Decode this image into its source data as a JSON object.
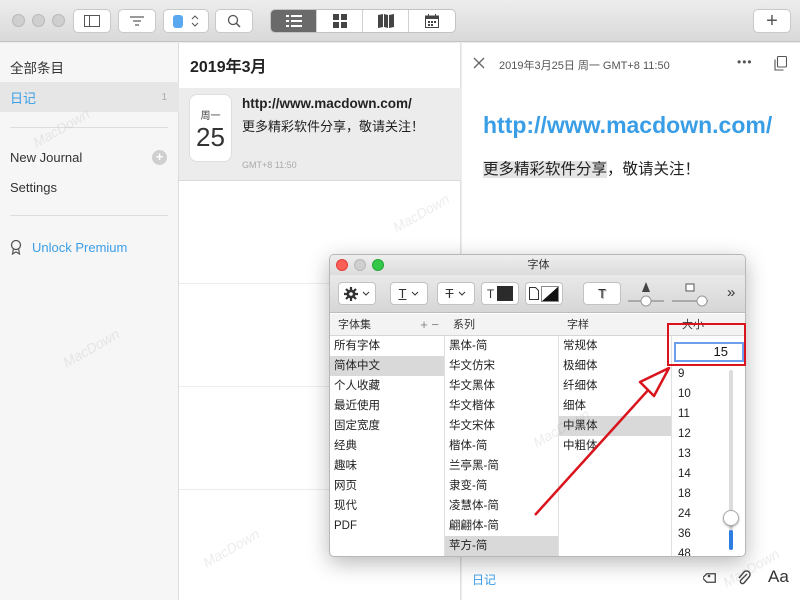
{
  "toolbar": {
    "add_label": "+"
  },
  "sidebar": {
    "all_entries": "全部条目",
    "journal": "日记",
    "journal_count": "1",
    "new_journal": "New Journal",
    "new_journal_plus": "+",
    "settings": "Settings",
    "unlock": "Unlock Premium"
  },
  "list": {
    "month": "2019年3月",
    "entry": {
      "weekday": "周一",
      "day": "25",
      "title": "http://www.macdown.com/",
      "body": "更多精彩软件分享，敬请关注！",
      "time": "GMT+8 11:50"
    }
  },
  "detail": {
    "datetime": "2019年3月25日 周一 GMT+8 11:50",
    "more": "•••",
    "link": "http://www.macdown.com/",
    "body_highlight": "更多精彩软件分享",
    "body_rest": "，敬请关注！",
    "journal_tag": "日记",
    "font_button": "Aa"
  },
  "font_panel": {
    "title": "字体",
    "columns": {
      "collection": "字体集",
      "family": "系列",
      "typeface": "字样",
      "size": "大小"
    },
    "collection_actions": "+ −",
    "overflow": "»",
    "collections": [
      "所有字体",
      "简体中文",
      "个人收藏",
      "最近使用",
      "固定宽度",
      "经典",
      "趣味",
      "网页",
      "现代",
      "PDF"
    ],
    "families": [
      "黑体-简",
      "华文仿宋",
      "华文黑体",
      "华文楷体",
      "华文宋体",
      "楷体-简",
      "兰亭黑-简",
      "隶变-简",
      "凌慧体-简",
      "翩翩体-简",
      "苹方-简"
    ],
    "typefaces": [
      "常规体",
      "极细体",
      "纤细体",
      "细体",
      "中黑体",
      "中粗体"
    ],
    "size_value": "15",
    "sizes": [
      "9",
      "10",
      "11",
      "12",
      "13",
      "14",
      "18",
      "24",
      "36",
      "48"
    ],
    "selected": {
      "collection": 1,
      "family": 10,
      "typeface": 4
    }
  },
  "colors": {
    "accent_blue": "#3a9ee6",
    "link_blue": "#3a9ee6",
    "annotation_red": "#d9141d"
  }
}
